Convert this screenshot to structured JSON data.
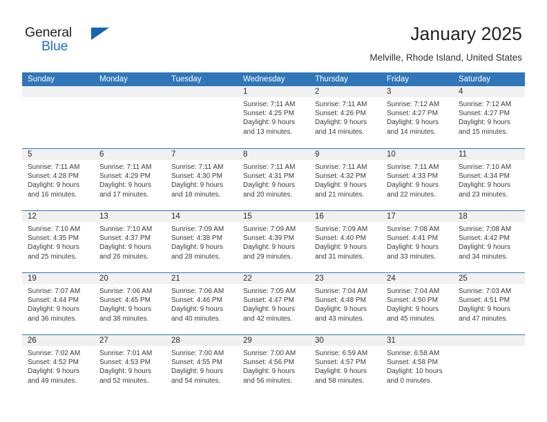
{
  "brand": {
    "name_part1": "General",
    "name_part2": "Blue",
    "accent_color": "#1565b0"
  },
  "header": {
    "title": "January 2025",
    "location": "Melville, Rhode Island, United States"
  },
  "theme": {
    "header_bg": "#3076b8",
    "daynum_bg": "#f1f1f1",
    "rule_color": "#3076b8"
  },
  "weekdays": [
    "Sunday",
    "Monday",
    "Tuesday",
    "Wednesday",
    "Thursday",
    "Friday",
    "Saturday"
  ],
  "labels": {
    "sunrise_prefix": "Sunrise:",
    "sunset_prefix": "Sunset:",
    "daylight_prefix": "Daylight:"
  },
  "weeks": [
    [
      {
        "day": "",
        "sunrise": "",
        "sunset": "",
        "daylight_line1": "",
        "daylight_line2": ""
      },
      {
        "day": "",
        "sunrise": "",
        "sunset": "",
        "daylight_line1": "",
        "daylight_line2": ""
      },
      {
        "day": "",
        "sunrise": "",
        "sunset": "",
        "daylight_line1": "",
        "daylight_line2": ""
      },
      {
        "day": "1",
        "sunrise": "Sunrise: 7:11 AM",
        "sunset": "Sunset: 4:25 PM",
        "daylight_line1": "Daylight: 9 hours",
        "daylight_line2": "and 13 minutes."
      },
      {
        "day": "2",
        "sunrise": "Sunrise: 7:11 AM",
        "sunset": "Sunset: 4:26 PM",
        "daylight_line1": "Daylight: 9 hours",
        "daylight_line2": "and 14 minutes."
      },
      {
        "day": "3",
        "sunrise": "Sunrise: 7:12 AM",
        "sunset": "Sunset: 4:27 PM",
        "daylight_line1": "Daylight: 9 hours",
        "daylight_line2": "and 14 minutes."
      },
      {
        "day": "4",
        "sunrise": "Sunrise: 7:12 AM",
        "sunset": "Sunset: 4:27 PM",
        "daylight_line1": "Daylight: 9 hours",
        "daylight_line2": "and 15 minutes."
      }
    ],
    [
      {
        "day": "5",
        "sunrise": "Sunrise: 7:11 AM",
        "sunset": "Sunset: 4:28 PM",
        "daylight_line1": "Daylight: 9 hours",
        "daylight_line2": "and 16 minutes."
      },
      {
        "day": "6",
        "sunrise": "Sunrise: 7:11 AM",
        "sunset": "Sunset: 4:29 PM",
        "daylight_line1": "Daylight: 9 hours",
        "daylight_line2": "and 17 minutes."
      },
      {
        "day": "7",
        "sunrise": "Sunrise: 7:11 AM",
        "sunset": "Sunset: 4:30 PM",
        "daylight_line1": "Daylight: 9 hours",
        "daylight_line2": "and 18 minutes."
      },
      {
        "day": "8",
        "sunrise": "Sunrise: 7:11 AM",
        "sunset": "Sunset: 4:31 PM",
        "daylight_line1": "Daylight: 9 hours",
        "daylight_line2": "and 20 minutes."
      },
      {
        "day": "9",
        "sunrise": "Sunrise: 7:11 AM",
        "sunset": "Sunset: 4:32 PM",
        "daylight_line1": "Daylight: 9 hours",
        "daylight_line2": "and 21 minutes."
      },
      {
        "day": "10",
        "sunrise": "Sunrise: 7:11 AM",
        "sunset": "Sunset: 4:33 PM",
        "daylight_line1": "Daylight: 9 hours",
        "daylight_line2": "and 22 minutes."
      },
      {
        "day": "11",
        "sunrise": "Sunrise: 7:10 AM",
        "sunset": "Sunset: 4:34 PM",
        "daylight_line1": "Daylight: 9 hours",
        "daylight_line2": "and 23 minutes."
      }
    ],
    [
      {
        "day": "12",
        "sunrise": "Sunrise: 7:10 AM",
        "sunset": "Sunset: 4:35 PM",
        "daylight_line1": "Daylight: 9 hours",
        "daylight_line2": "and 25 minutes."
      },
      {
        "day": "13",
        "sunrise": "Sunrise: 7:10 AM",
        "sunset": "Sunset: 4:37 PM",
        "daylight_line1": "Daylight: 9 hours",
        "daylight_line2": "and 26 minutes."
      },
      {
        "day": "14",
        "sunrise": "Sunrise: 7:09 AM",
        "sunset": "Sunset: 4:38 PM",
        "daylight_line1": "Daylight: 9 hours",
        "daylight_line2": "and 28 minutes."
      },
      {
        "day": "15",
        "sunrise": "Sunrise: 7:09 AM",
        "sunset": "Sunset: 4:39 PM",
        "daylight_line1": "Daylight: 9 hours",
        "daylight_line2": "and 29 minutes."
      },
      {
        "day": "16",
        "sunrise": "Sunrise: 7:09 AM",
        "sunset": "Sunset: 4:40 PM",
        "daylight_line1": "Daylight: 9 hours",
        "daylight_line2": "and 31 minutes."
      },
      {
        "day": "17",
        "sunrise": "Sunrise: 7:08 AM",
        "sunset": "Sunset: 4:41 PM",
        "daylight_line1": "Daylight: 9 hours",
        "daylight_line2": "and 33 minutes."
      },
      {
        "day": "18",
        "sunrise": "Sunrise: 7:08 AM",
        "sunset": "Sunset: 4:42 PM",
        "daylight_line1": "Daylight: 9 hours",
        "daylight_line2": "and 34 minutes."
      }
    ],
    [
      {
        "day": "19",
        "sunrise": "Sunrise: 7:07 AM",
        "sunset": "Sunset: 4:44 PM",
        "daylight_line1": "Daylight: 9 hours",
        "daylight_line2": "and 36 minutes."
      },
      {
        "day": "20",
        "sunrise": "Sunrise: 7:06 AM",
        "sunset": "Sunset: 4:45 PM",
        "daylight_line1": "Daylight: 9 hours",
        "daylight_line2": "and 38 minutes."
      },
      {
        "day": "21",
        "sunrise": "Sunrise: 7:06 AM",
        "sunset": "Sunset: 4:46 PM",
        "daylight_line1": "Daylight: 9 hours",
        "daylight_line2": "and 40 minutes."
      },
      {
        "day": "22",
        "sunrise": "Sunrise: 7:05 AM",
        "sunset": "Sunset: 4:47 PM",
        "daylight_line1": "Daylight: 9 hours",
        "daylight_line2": "and 42 minutes."
      },
      {
        "day": "23",
        "sunrise": "Sunrise: 7:04 AM",
        "sunset": "Sunset: 4:48 PM",
        "daylight_line1": "Daylight: 9 hours",
        "daylight_line2": "and 43 minutes."
      },
      {
        "day": "24",
        "sunrise": "Sunrise: 7:04 AM",
        "sunset": "Sunset: 4:50 PM",
        "daylight_line1": "Daylight: 9 hours",
        "daylight_line2": "and 45 minutes."
      },
      {
        "day": "25",
        "sunrise": "Sunrise: 7:03 AM",
        "sunset": "Sunset: 4:51 PM",
        "daylight_line1": "Daylight: 9 hours",
        "daylight_line2": "and 47 minutes."
      }
    ],
    [
      {
        "day": "26",
        "sunrise": "Sunrise: 7:02 AM",
        "sunset": "Sunset: 4:52 PM",
        "daylight_line1": "Daylight: 9 hours",
        "daylight_line2": "and 49 minutes."
      },
      {
        "day": "27",
        "sunrise": "Sunrise: 7:01 AM",
        "sunset": "Sunset: 4:53 PM",
        "daylight_line1": "Daylight: 9 hours",
        "daylight_line2": "and 52 minutes."
      },
      {
        "day": "28",
        "sunrise": "Sunrise: 7:00 AM",
        "sunset": "Sunset: 4:55 PM",
        "daylight_line1": "Daylight: 9 hours",
        "daylight_line2": "and 54 minutes."
      },
      {
        "day": "29",
        "sunrise": "Sunrise: 7:00 AM",
        "sunset": "Sunset: 4:56 PM",
        "daylight_line1": "Daylight: 9 hours",
        "daylight_line2": "and 56 minutes."
      },
      {
        "day": "30",
        "sunrise": "Sunrise: 6:59 AM",
        "sunset": "Sunset: 4:57 PM",
        "daylight_line1": "Daylight: 9 hours",
        "daylight_line2": "and 58 minutes."
      },
      {
        "day": "31",
        "sunrise": "Sunrise: 6:58 AM",
        "sunset": "Sunset: 4:58 PM",
        "daylight_line1": "Daylight: 10 hours",
        "daylight_line2": "and 0 minutes."
      },
      {
        "day": "",
        "sunrise": "",
        "sunset": "",
        "daylight_line1": "",
        "daylight_line2": ""
      }
    ]
  ]
}
